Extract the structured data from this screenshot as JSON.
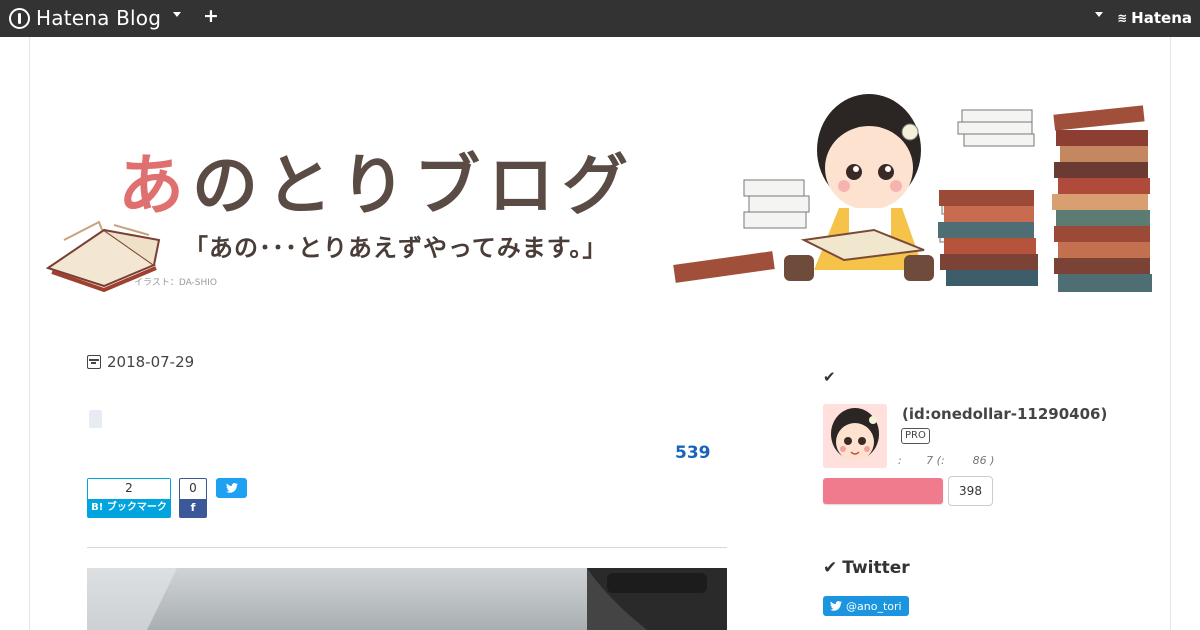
{
  "topbar": {
    "logo_text": "Hatena Blog",
    "plus_label": "+",
    "hatena_label": "Hatena"
  },
  "banner": {
    "title_first": "あ",
    "title_rest": "のとりブログ",
    "subtitle": "「あの･･･とりあえずやってみます。」",
    "credit": "イラスト：DA-SHIO"
  },
  "article": {
    "date": "2018-07-29",
    "read_count": "539",
    "hatebu_count": "2",
    "hatebu_label": "B! ブックマーク",
    "fb_count": "0",
    "fb_label": "f"
  },
  "sidebar": {
    "profile_id": "(id:onedollar-11290406)",
    "pro_badge": "PRO",
    "stats": ":       7 (:        86 )",
    "follow_count": "398",
    "twitter_heading": "Twitter",
    "twitter_handle": "@ano_tori"
  },
  "colors": {
    "topbar": "#333333",
    "hatebu": "#00a4de",
    "facebook": "#3b5998",
    "twitter": "#1da1f2",
    "follow": "#f07b8d",
    "read_count": "#1a64b8"
  }
}
